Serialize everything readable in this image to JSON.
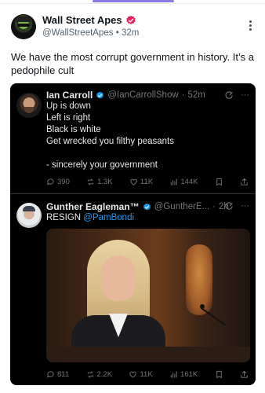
{
  "outer": {
    "name": "Wall Street Apes",
    "handle": "@WallStreetApes",
    "separator": "•",
    "time": "32m",
    "text": "We have the most corrupt government in history. It’s a pedophile cult",
    "verified_color": "#e0245e"
  },
  "quote1": {
    "name": "Ian Carroll",
    "handle": "@IanCarrollShow",
    "separator": "·",
    "time": "52m",
    "text": "Up is down\nLeft is right\nBlack is white\nGet wrecked you filthy peasants\n\n- sincerely your government",
    "more": "···",
    "actions": {
      "replies": "390",
      "reposts": "1.3K",
      "likes": "11K",
      "views": "144K"
    }
  },
  "quote2": {
    "name": "Gunther Eagleman™",
    "handle": "@GuntherE...",
    "separator": "·",
    "time": "2h",
    "text_prefix": "RESIGN ",
    "mention": "@PamBondi",
    "more": "···",
    "actions": {
      "replies": "811",
      "reposts": "2.2K",
      "likes": "11K",
      "views": "161K"
    }
  },
  "colors": {
    "card_bg": "#000000",
    "link": "#1d9bf0",
    "verified_blue": "#1d9bf0",
    "muted": "#71767b",
    "tab_indicator": "#8b78e6"
  },
  "icons": [
    "verified-badge-icon",
    "kebab-menu-icon",
    "grok-icon",
    "more-icon",
    "reply-icon",
    "repost-icon",
    "like-icon",
    "views-icon",
    "bookmark-icon",
    "share-icon"
  ]
}
